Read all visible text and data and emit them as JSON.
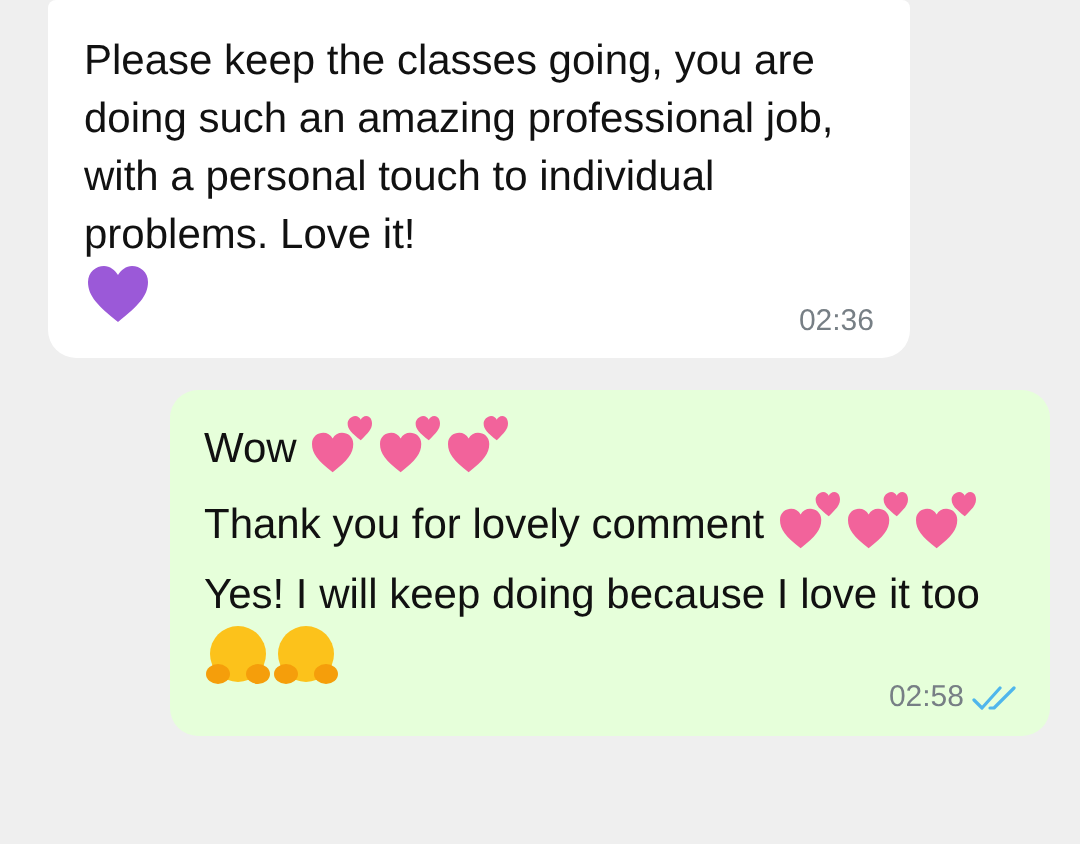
{
  "messages": [
    {
      "kind": "incoming",
      "paragraphs": [
        {
          "text": "Please keep the classes going, you are doing such an amazing professional job, with a personal touch to individual problems. Love it!"
        },
        {
          "emoji": [
            {
              "kind": "purple_heart"
            }
          ]
        }
      ],
      "time": "02:36"
    },
    {
      "kind": "outgoing",
      "paragraphs": [
        {
          "text": "Wow",
          "emoji": [
            {
              "kind": "two_hearts"
            },
            {
              "kind": "two_hearts"
            },
            {
              "kind": "two_hearts"
            }
          ]
        },
        {
          "text": "Thank you for lovely comment",
          "emoji": [
            {
              "kind": "two_hearts"
            },
            {
              "kind": "two_hearts"
            },
            {
              "kind": "two_hearts"
            }
          ]
        },
        {
          "text": "Yes! I will keep doing because I love it too",
          "emoji": [
            {
              "kind": "hug"
            },
            {
              "kind": "hug"
            }
          ]
        }
      ],
      "time": "02:58",
      "read": true
    }
  ]
}
